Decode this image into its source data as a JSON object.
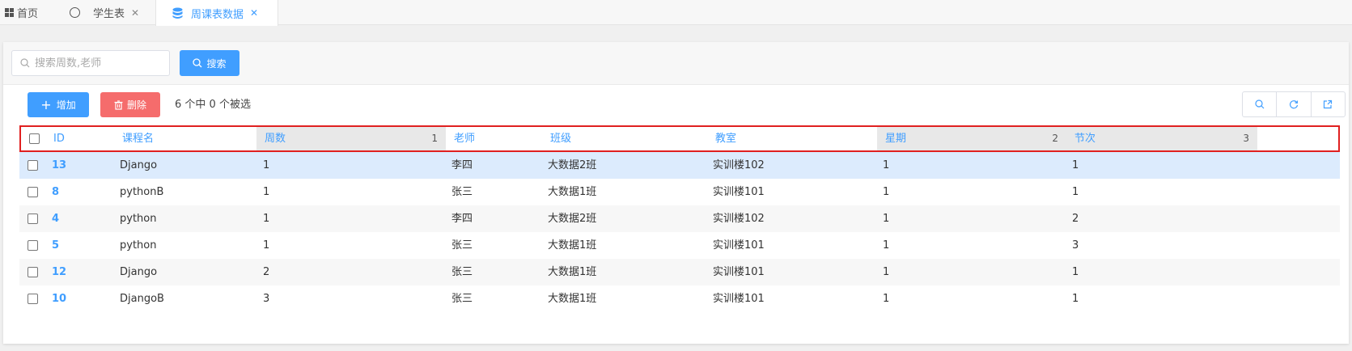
{
  "tabs": [
    {
      "label": "首页",
      "icon": "grid-icon",
      "active": false
    },
    {
      "label": "学生表",
      "icon": "circle-icon",
      "active": false
    },
    {
      "label": "周课表数据",
      "icon": "database-icon",
      "active": true
    }
  ],
  "search": {
    "placeholder": "搜索周数,老师",
    "value": "",
    "button_label": "搜索"
  },
  "toolbar": {
    "add_label": "增加",
    "delete_label": "删除",
    "selection_text": "6 个中 0 个被选"
  },
  "table": {
    "columns": [
      {
        "label": "ID",
        "sort_order": ""
      },
      {
        "label": "课程名",
        "sort_order": ""
      },
      {
        "label": "周数",
        "sort_order": "1"
      },
      {
        "label": "老师",
        "sort_order": ""
      },
      {
        "label": "班级",
        "sort_order": ""
      },
      {
        "label": "教室",
        "sort_order": ""
      },
      {
        "label": "星期",
        "sort_order": "2"
      },
      {
        "label": "节次",
        "sort_order": "3"
      }
    ],
    "rows": [
      {
        "id": "13",
        "course": "Django",
        "week": "1",
        "teacher": "李四",
        "class": "大数据2班",
        "room": "实训楼102",
        "weekday": "1",
        "period": "1"
      },
      {
        "id": "8",
        "course": "pythonB",
        "week": "1",
        "teacher": "张三",
        "class": "大数据1班",
        "room": "实训楼101",
        "weekday": "1",
        "period": "1"
      },
      {
        "id": "4",
        "course": "python",
        "week": "1",
        "teacher": "李四",
        "class": "大数据2班",
        "room": "实训楼102",
        "weekday": "1",
        "period": "2"
      },
      {
        "id": "5",
        "course": "python",
        "week": "1",
        "teacher": "张三",
        "class": "大数据1班",
        "room": "实训楼101",
        "weekday": "1",
        "period": "3"
      },
      {
        "id": "12",
        "course": "Django",
        "week": "2",
        "teacher": "张三",
        "class": "大数据1班",
        "room": "实训楼101",
        "weekday": "1",
        "period": "1"
      },
      {
        "id": "10",
        "course": "DjangoB",
        "week": "3",
        "teacher": "张三",
        "class": "大数据1班",
        "room": "实训楼101",
        "weekday": "1",
        "period": "1"
      }
    ]
  },
  "colors": {
    "accent": "#409eff",
    "danger": "#f56c6c",
    "highlight_border": "#e02020",
    "selected_row": "#dcebfd"
  }
}
